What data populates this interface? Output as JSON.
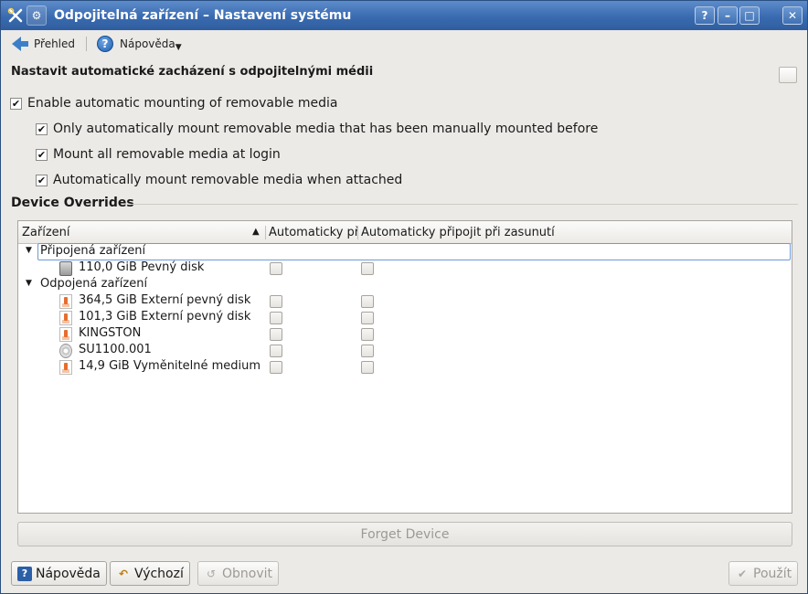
{
  "window": {
    "title": "Odpojitelná zařízení – Nastavení systému",
    "controls": [
      "?",
      "–",
      "□",
      "✕"
    ]
  },
  "toolbar": {
    "overview": "Přehled",
    "help": "Nápověda"
  },
  "heading": "Nastavit automatické zacházení s odpojitelnými médii",
  "options": {
    "enable": {
      "label": "Enable automatic mounting of removable media",
      "checked": true
    },
    "only_manual": {
      "label": "Only automatically mount removable media that has been manually mounted before",
      "checked": true
    },
    "at_login": {
      "label": "Mount all removable media at login",
      "checked": true
    },
    "when_attached": {
      "label": "Automatically mount removable media when attached",
      "checked": true
    }
  },
  "overrides": {
    "title": "Device Overrides",
    "columns": [
      "Zařízení",
      "Automaticky při",
      "Automaticky připojit při zasunutí"
    ],
    "groups": [
      {
        "label": "Připojená zařízení",
        "devices": [
          {
            "label": "110,0 GiB Pevný disk",
            "icon": "hard-disk-icon"
          }
        ]
      },
      {
        "label": "Odpojená zařízení",
        "devices": [
          {
            "label": "364,5 GiB Externí pevný disk",
            "icon": "external-disk-icon"
          },
          {
            "label": "101,3 GiB Externí pevný disk",
            "icon": "external-disk-icon"
          },
          {
            "label": "KINGSTON",
            "icon": "external-disk-icon"
          },
          {
            "label": "SU1100.001",
            "icon": "optical-disc-icon"
          },
          {
            "label": "14,9 GiB Vyměnitelné medium",
            "icon": "external-disk-icon"
          }
        ]
      }
    ]
  },
  "buttons": {
    "forget": "Forget Device",
    "help": "Nápověda",
    "defaults": "Výchozí",
    "reset": "Obnovit",
    "apply": "Použít"
  }
}
